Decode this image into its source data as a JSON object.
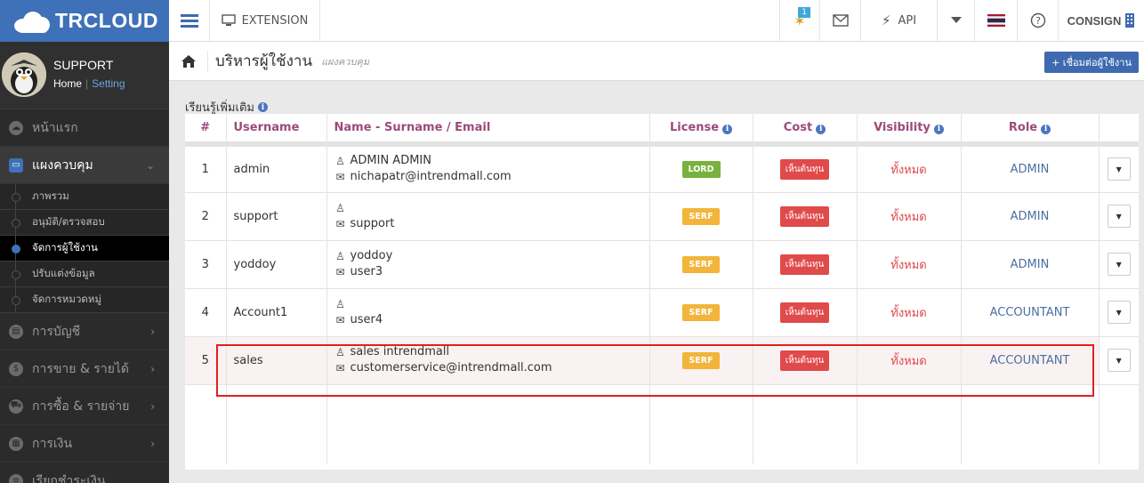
{
  "app": {
    "logo": "TRCLOUD"
  },
  "profile": {
    "name": "SUPPORT",
    "home": "Home",
    "setting": "Setting"
  },
  "sidebar": {
    "items": [
      {
        "label": "หน้าแรก",
        "icon": "cloud-icon"
      },
      {
        "label": "แผงควบคุม",
        "icon": "monitor-icon",
        "active": true
      }
    ],
    "sub_items": [
      {
        "label": "ภาพรวม"
      },
      {
        "label": "อนุมัติ/ตรวจสอบ"
      },
      {
        "label": "จัดการผู้ใช้งาน",
        "active": true
      },
      {
        "label": "ปรับแต่งข้อมูล"
      },
      {
        "label": "จัดการหมวดหมู่"
      }
    ],
    "more_items": [
      {
        "label": "การบัญชี",
        "icon": "book-icon"
      },
      {
        "label": "การขาย & รายได้",
        "icon": "dollar-icon"
      },
      {
        "label": "การซื้อ & รายจ่าย",
        "icon": "cart-icon"
      },
      {
        "label": "การเงิน",
        "icon": "calendar-icon"
      },
      {
        "label": "เรียกชำระเงิน",
        "icon": "list-icon"
      }
    ]
  },
  "topbar": {
    "extension": "EXTENSION",
    "notify_count": "1",
    "api": "API",
    "consign": "CONSIGN"
  },
  "page": {
    "title": "บริหารผู้ใช้งาน",
    "subtitle": "แผงควบคุม",
    "connect_button": "+ เชื่อมต่อผู้ใช้งาน",
    "learn_more": "เรียนรู้เพิ่มเติม"
  },
  "table": {
    "headers": {
      "num": "#",
      "username": "Username",
      "name": "Name - Surname / Email",
      "license": "License",
      "cost": "Cost",
      "visibility": "Visibility",
      "role": "Role"
    },
    "rows": [
      {
        "num": "1",
        "username": "admin",
        "fullname": "ADMIN ADMIN",
        "email": "nichapatr@intrendmall.com",
        "license": "LORD",
        "cost": "เห็นต้นทุน",
        "visibility": "ทั้งหมด",
        "role": "ADMIN"
      },
      {
        "num": "2",
        "username": "support",
        "fullname": "",
        "email": "support",
        "license": "SERF",
        "cost": "เห็นต้นทุน",
        "visibility": "ทั้งหมด",
        "role": "ADMIN"
      },
      {
        "num": "3",
        "username": "yoddoy",
        "fullname": "yoddoy",
        "email": "user3",
        "license": "SERF",
        "cost": "เห็นต้นทุน",
        "visibility": "ทั้งหมด",
        "role": "ADMIN"
      },
      {
        "num": "4",
        "username": "Account1",
        "fullname": "",
        "email": "user4",
        "license": "SERF",
        "cost": "เห็นต้นทุน",
        "visibility": "ทั้งหมด",
        "role": "ACCOUNTANT"
      },
      {
        "num": "5",
        "username": "sales",
        "fullname": "sales intrendmall",
        "email": "customerservice@intrendmall.com",
        "license": "SERF",
        "cost": "เห็นต้นทุน",
        "visibility": "ทั้งหมด",
        "role": "ACCOUNTANT",
        "highlighted": true
      }
    ]
  },
  "colors": {
    "brand": "#3f71b8",
    "header_text": "#9c4a7a",
    "lord": "#78b13f",
    "serf": "#f3b43a",
    "cost": "#e04a4a",
    "role": "#4a6fa5",
    "highlight": "#e02020"
  }
}
